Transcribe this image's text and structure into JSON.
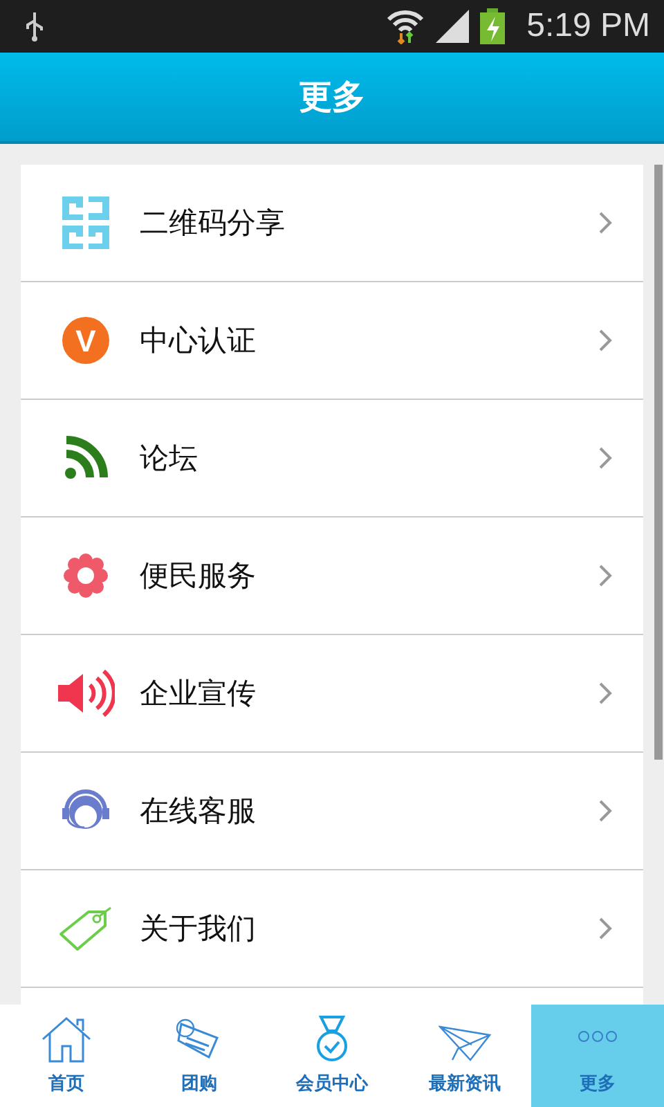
{
  "status_bar": {
    "time": "5:19 PM"
  },
  "header": {
    "title": "更多"
  },
  "menu": [
    {
      "label": "二维码分享",
      "kind": "qr"
    },
    {
      "label": "中心认证",
      "kind": "badge",
      "icon_text": "V"
    },
    {
      "label": "论坛",
      "kind": "rss"
    },
    {
      "label": "便民服务",
      "kind": "flower"
    },
    {
      "label": "企业宣传",
      "kind": "speaker"
    },
    {
      "label": "在线客服",
      "kind": "agent"
    },
    {
      "label": "关于我们",
      "kind": "tag"
    }
  ],
  "tabs": [
    {
      "label": "首页",
      "kind": "home",
      "selected": false
    },
    {
      "label": "团购",
      "kind": "sale",
      "selected": false
    },
    {
      "label": "会员中心",
      "kind": "medal",
      "selected": false
    },
    {
      "label": "最新资讯",
      "kind": "plane",
      "selected": false
    },
    {
      "label": "更多",
      "kind": "dots",
      "selected": true
    }
  ]
}
